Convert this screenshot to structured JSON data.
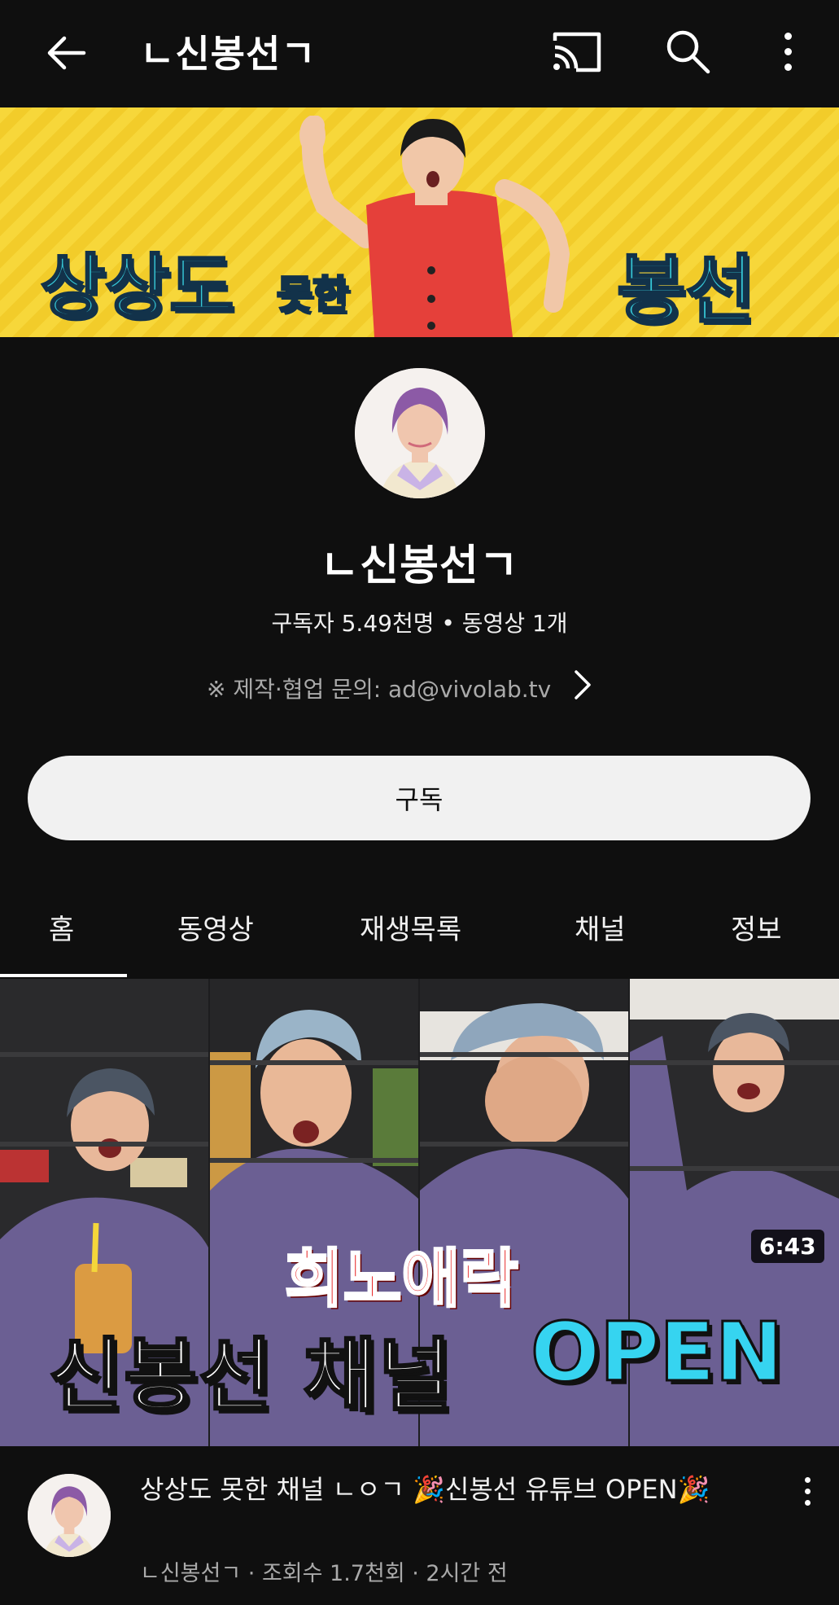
{
  "header": {
    "title": "ㄴ신봉선ㄱ",
    "icons": [
      "back-arrow-icon",
      "cast-icon",
      "search-icon",
      "more-vertical-icon"
    ]
  },
  "banner": {
    "text_left": "상상도",
    "text_left_small": "못한",
    "text_right": "봉선",
    "background_color": "#f7d73a",
    "text_color": "#36c7d6"
  },
  "channel": {
    "name": "ㄴ신봉선ㄱ",
    "stats": "구독자 5.49천명 • 동영상 1개",
    "contact": "※ 제작·협업 문의: ad@vivolab.tv",
    "subscribe_label": "구독"
  },
  "tabs": [
    {
      "label": "홈",
      "selected": true
    },
    {
      "label": "동영상",
      "selected": false
    },
    {
      "label": "재생목록",
      "selected": false
    },
    {
      "label": "채널",
      "selected": false
    },
    {
      "label": "정보",
      "selected": false
    }
  ],
  "video": {
    "thumbnail_text_top": "희노애락",
    "thumbnail_text_main": "신봉선 채널",
    "thumbnail_text_open": "OPEN",
    "duration": "6:43",
    "title": "상상도 못한 채널 ㄴㅇㄱ 🎉신봉선 유튜브 OPEN🎉",
    "meta": "ㄴ신봉선ㄱ · 조회수 1.7천회 · 2시간 전"
  },
  "colors": {
    "background": "#0f0f0f",
    "subscribe_bg": "#f1f1f1",
    "secondary_text": "#aaaaaa"
  }
}
